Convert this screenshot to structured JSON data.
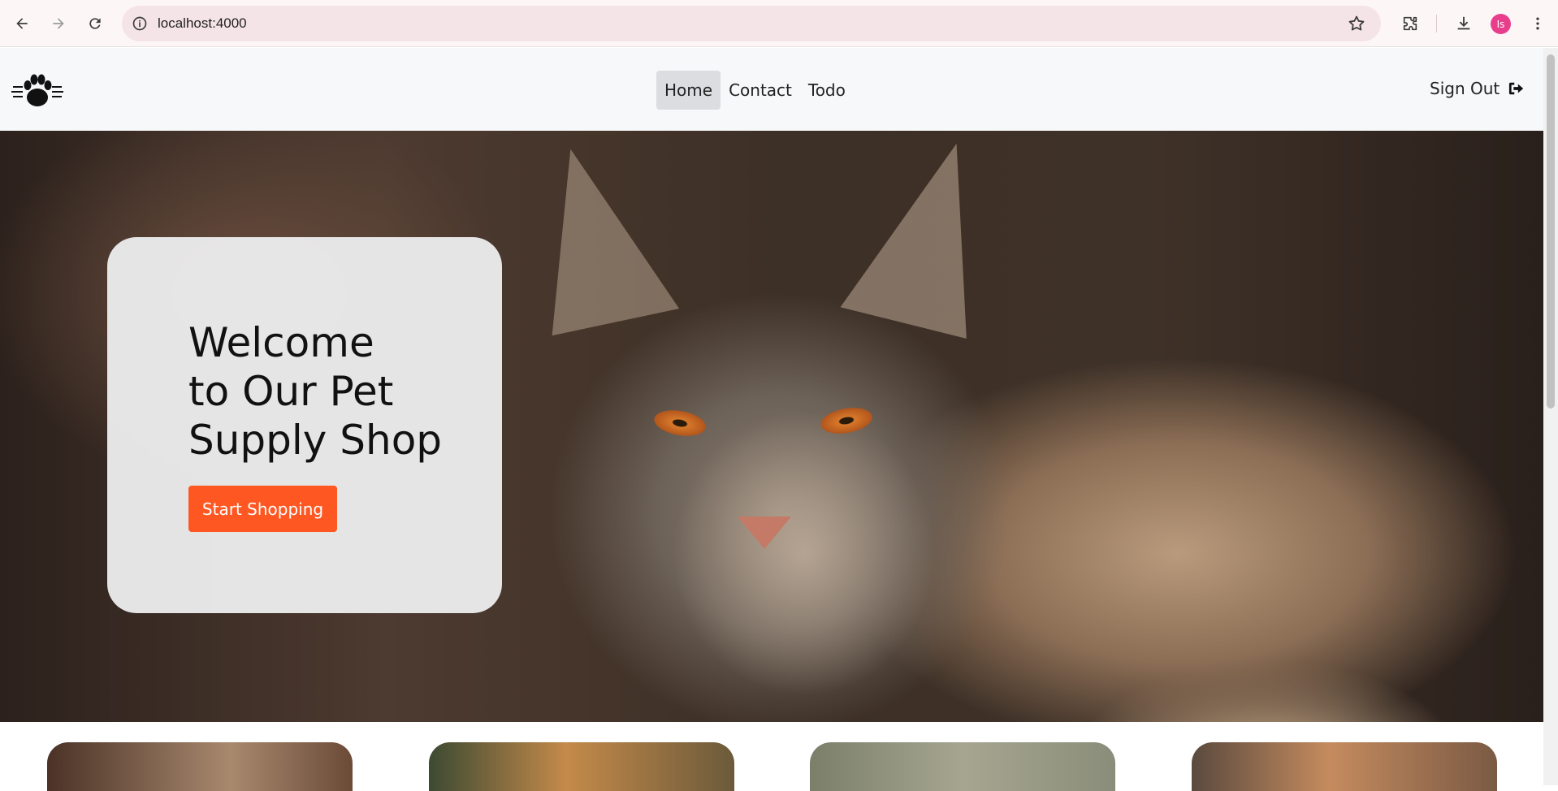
{
  "browser": {
    "url": "localhost:4000",
    "profile_initials": "Is",
    "icons": {
      "back": "arrow-left-icon",
      "forward": "arrow-right-icon",
      "reload": "reload-icon",
      "site_info": "info-icon",
      "bookmark": "star-icon",
      "extensions": "puzzle-icon",
      "downloads": "download-icon",
      "menu": "kebab-menu-icon"
    }
  },
  "header": {
    "logo_icon": "paw-icon",
    "nav": [
      {
        "label": "Home",
        "active": true
      },
      {
        "label": "Contact",
        "active": false
      },
      {
        "label": "Todo",
        "active": false
      }
    ],
    "signout_label": "Sign Out",
    "signout_icon": "sign-out-icon"
  },
  "hero": {
    "title_lines": [
      "Welcome",
      "to Our Pet",
      "Supply Shop"
    ],
    "cta_label": "Start Shopping"
  },
  "colors": {
    "accent": "#ff5722",
    "header_bg": "#f7f8fa",
    "active_nav_bg": "#dcdde0",
    "profile_bg": "#e83e8c"
  }
}
